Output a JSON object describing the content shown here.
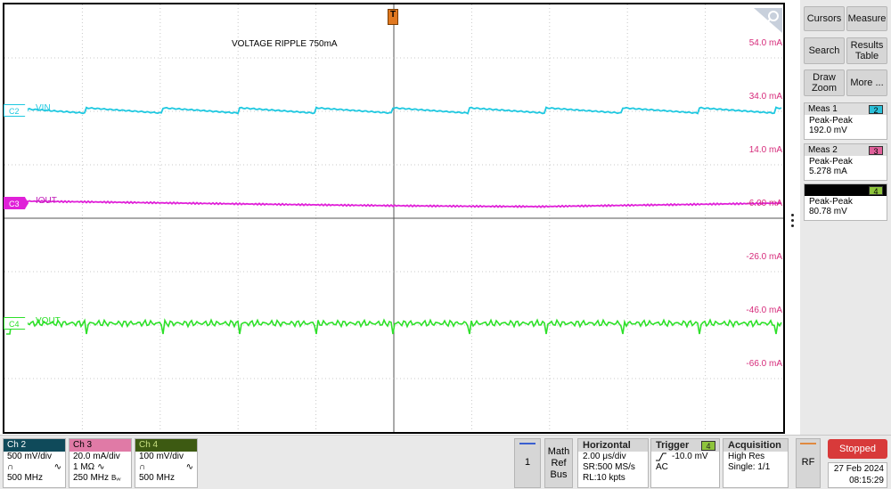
{
  "waveform": {
    "annotation": "VOLTAGE RIPPLE 750mA",
    "trigger_marker": "T",
    "scale_labels": [
      "54.0 mA",
      "34.0 mA",
      "14.0 mA",
      "-6.00 mA",
      "-26.0 mA",
      "-46.0 mA",
      "-66.0 mA"
    ],
    "traces": [
      {
        "channel": "C2",
        "name": "VIN",
        "color": "#1ec8e0"
      },
      {
        "channel": "C3",
        "name": "IOUT",
        "color": "#e020d8"
      },
      {
        "channel": "C4",
        "name": "VOUT",
        "color": "#2ee02a"
      }
    ],
    "scale_color": "#d62a7a"
  },
  "side_panel": {
    "buttons": {
      "cursors": "Cursors",
      "measure": "Measure",
      "search": "Search",
      "results_table_1": "Results",
      "results_table_2": "Table",
      "draw_zoom_1": "Draw",
      "draw_zoom_2": "Zoom",
      "more": "More ..."
    },
    "measurements": [
      {
        "title": "Meas 1",
        "channel": "2",
        "chip_color": "#2bbfd8",
        "type": "Peak-Peak",
        "value": "192.0 mV"
      },
      {
        "title": "Meas 2",
        "channel": "3",
        "chip_color": "#e0609a",
        "type": "Peak-Peak",
        "value": "5.278 mA"
      },
      {
        "title": "",
        "channel": "4",
        "chip_color": "#8ec43c",
        "type": "Peak-Peak",
        "value": "80.78 mV"
      }
    ]
  },
  "bottom_bar": {
    "channels": [
      {
        "label": "Ch 2",
        "head_color": "#0f4a5a",
        "head_text": "#ffffff",
        "scale": "500 mV/div",
        "coupling": "∿",
        "bandwidth": "500 MHz",
        "probe_icon": "∩",
        "impedance": ""
      },
      {
        "label": "Ch 3",
        "head_color": "#e07aa6",
        "head_text": "#000000",
        "scale": "20.0 mA/div",
        "coupling": "∿",
        "bandwidth": "250 MHz",
        "probe_icon": "",
        "impedance": "1 MΩ",
        "bw_suffix": "Bᵥᵥ"
      },
      {
        "label": "Ch 4",
        "head_color": "#3d5a12",
        "head_text": "#c8e080",
        "scale": "100 mV/div",
        "coupling": "∿",
        "bandwidth": "500 MHz",
        "probe_icon": "∩",
        "impedance": ""
      }
    ],
    "page_button": "1",
    "math_ref_bus": [
      "Math",
      "Ref",
      "Bus"
    ],
    "horizontal": {
      "title": "Horizontal",
      "scale": "2.00 μs/div",
      "sample_rate": "SR:500 MS/s",
      "record_length": "RL:10 kpts"
    },
    "trigger": {
      "title": "Trigger",
      "source": "4",
      "level": "-10.0 mV",
      "coupling": "AC"
    },
    "acquisition": {
      "title": "Acquisition",
      "mode": "High Res",
      "single": "Single: 1/1"
    },
    "rf_button": "RF",
    "run_state": "Stopped",
    "run_state_color": "#d83a3a",
    "date": "27 Feb 2024",
    "time": "08:15:29"
  }
}
